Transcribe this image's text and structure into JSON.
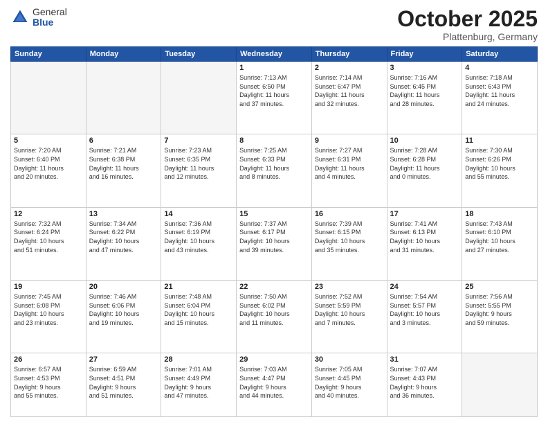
{
  "logo": {
    "general": "General",
    "blue": "Blue"
  },
  "header": {
    "month": "October 2025",
    "location": "Plattenburg, Germany"
  },
  "weekdays": [
    "Sunday",
    "Monday",
    "Tuesday",
    "Wednesday",
    "Thursday",
    "Friday",
    "Saturday"
  ],
  "weeks": [
    [
      {
        "day": "",
        "info": ""
      },
      {
        "day": "",
        "info": ""
      },
      {
        "day": "",
        "info": ""
      },
      {
        "day": "1",
        "info": "Sunrise: 7:13 AM\nSunset: 6:50 PM\nDaylight: 11 hours\nand 37 minutes."
      },
      {
        "day": "2",
        "info": "Sunrise: 7:14 AM\nSunset: 6:47 PM\nDaylight: 11 hours\nand 32 minutes."
      },
      {
        "day": "3",
        "info": "Sunrise: 7:16 AM\nSunset: 6:45 PM\nDaylight: 11 hours\nand 28 minutes."
      },
      {
        "day": "4",
        "info": "Sunrise: 7:18 AM\nSunset: 6:43 PM\nDaylight: 11 hours\nand 24 minutes."
      }
    ],
    [
      {
        "day": "5",
        "info": "Sunrise: 7:20 AM\nSunset: 6:40 PM\nDaylight: 11 hours\nand 20 minutes."
      },
      {
        "day": "6",
        "info": "Sunrise: 7:21 AM\nSunset: 6:38 PM\nDaylight: 11 hours\nand 16 minutes."
      },
      {
        "day": "7",
        "info": "Sunrise: 7:23 AM\nSunset: 6:35 PM\nDaylight: 11 hours\nand 12 minutes."
      },
      {
        "day": "8",
        "info": "Sunrise: 7:25 AM\nSunset: 6:33 PM\nDaylight: 11 hours\nand 8 minutes."
      },
      {
        "day": "9",
        "info": "Sunrise: 7:27 AM\nSunset: 6:31 PM\nDaylight: 11 hours\nand 4 minutes."
      },
      {
        "day": "10",
        "info": "Sunrise: 7:28 AM\nSunset: 6:28 PM\nDaylight: 11 hours\nand 0 minutes."
      },
      {
        "day": "11",
        "info": "Sunrise: 7:30 AM\nSunset: 6:26 PM\nDaylight: 10 hours\nand 55 minutes."
      }
    ],
    [
      {
        "day": "12",
        "info": "Sunrise: 7:32 AM\nSunset: 6:24 PM\nDaylight: 10 hours\nand 51 minutes."
      },
      {
        "day": "13",
        "info": "Sunrise: 7:34 AM\nSunset: 6:22 PM\nDaylight: 10 hours\nand 47 minutes."
      },
      {
        "day": "14",
        "info": "Sunrise: 7:36 AM\nSunset: 6:19 PM\nDaylight: 10 hours\nand 43 minutes."
      },
      {
        "day": "15",
        "info": "Sunrise: 7:37 AM\nSunset: 6:17 PM\nDaylight: 10 hours\nand 39 minutes."
      },
      {
        "day": "16",
        "info": "Sunrise: 7:39 AM\nSunset: 6:15 PM\nDaylight: 10 hours\nand 35 minutes."
      },
      {
        "day": "17",
        "info": "Sunrise: 7:41 AM\nSunset: 6:13 PM\nDaylight: 10 hours\nand 31 minutes."
      },
      {
        "day": "18",
        "info": "Sunrise: 7:43 AM\nSunset: 6:10 PM\nDaylight: 10 hours\nand 27 minutes."
      }
    ],
    [
      {
        "day": "19",
        "info": "Sunrise: 7:45 AM\nSunset: 6:08 PM\nDaylight: 10 hours\nand 23 minutes."
      },
      {
        "day": "20",
        "info": "Sunrise: 7:46 AM\nSunset: 6:06 PM\nDaylight: 10 hours\nand 19 minutes."
      },
      {
        "day": "21",
        "info": "Sunrise: 7:48 AM\nSunset: 6:04 PM\nDaylight: 10 hours\nand 15 minutes."
      },
      {
        "day": "22",
        "info": "Sunrise: 7:50 AM\nSunset: 6:02 PM\nDaylight: 10 hours\nand 11 minutes."
      },
      {
        "day": "23",
        "info": "Sunrise: 7:52 AM\nSunset: 5:59 PM\nDaylight: 10 hours\nand 7 minutes."
      },
      {
        "day": "24",
        "info": "Sunrise: 7:54 AM\nSunset: 5:57 PM\nDaylight: 10 hours\nand 3 minutes."
      },
      {
        "day": "25",
        "info": "Sunrise: 7:56 AM\nSunset: 5:55 PM\nDaylight: 9 hours\nand 59 minutes."
      }
    ],
    [
      {
        "day": "26",
        "info": "Sunrise: 6:57 AM\nSunset: 4:53 PM\nDaylight: 9 hours\nand 55 minutes."
      },
      {
        "day": "27",
        "info": "Sunrise: 6:59 AM\nSunset: 4:51 PM\nDaylight: 9 hours\nand 51 minutes."
      },
      {
        "day": "28",
        "info": "Sunrise: 7:01 AM\nSunset: 4:49 PM\nDaylight: 9 hours\nand 47 minutes."
      },
      {
        "day": "29",
        "info": "Sunrise: 7:03 AM\nSunset: 4:47 PM\nDaylight: 9 hours\nand 44 minutes."
      },
      {
        "day": "30",
        "info": "Sunrise: 7:05 AM\nSunset: 4:45 PM\nDaylight: 9 hours\nand 40 minutes."
      },
      {
        "day": "31",
        "info": "Sunrise: 7:07 AM\nSunset: 4:43 PM\nDaylight: 9 hours\nand 36 minutes."
      },
      {
        "day": "",
        "info": ""
      }
    ]
  ]
}
